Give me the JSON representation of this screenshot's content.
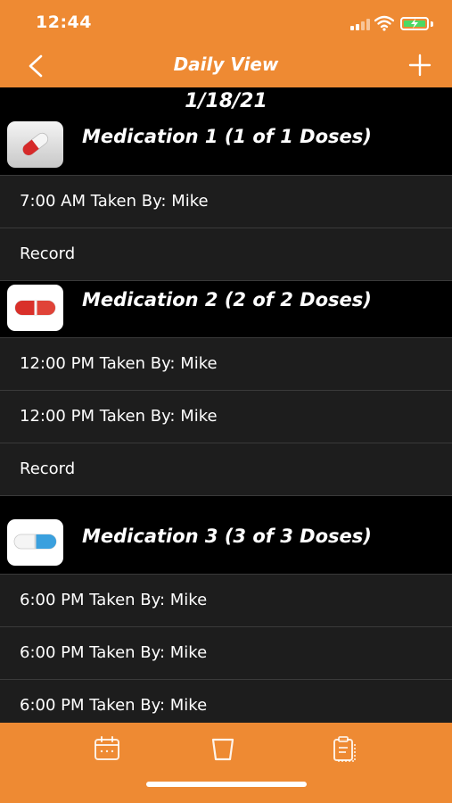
{
  "status": {
    "time": "12:44"
  },
  "nav": {
    "title": "Daily View"
  },
  "date": "1/18/21",
  "medications": [
    {
      "title": "Medication 1 (1 of 1 Doses)",
      "icon": "red-pill-icon",
      "entries": [
        "7:00 AM Taken By: Mike"
      ],
      "record_label": "Record"
    },
    {
      "title": "Medication 2 (2 of 2 Doses)",
      "icon": "red-white-capsule-icon",
      "entries": [
        "12:00 PM Taken By: Mike",
        "12:00 PM Taken By: Mike"
      ],
      "record_label": "Record"
    },
    {
      "title": "Medication 3 (3 of 3 Doses)",
      "icon": "blue-white-capsule-icon",
      "entries": [
        "6:00 PM Taken By: Mike",
        "6:00 PM Taken By: Mike",
        "6:00 PM Taken By: Mike"
      ]
    }
  ],
  "tabs": [
    {
      "icon": "calendar-icon"
    },
    {
      "icon": "trash-icon"
    },
    {
      "icon": "clipboard-icon"
    }
  ],
  "colors": {
    "accent": "#EE8A33",
    "row_bg": "#1D1D1D",
    "background": "#000000"
  }
}
